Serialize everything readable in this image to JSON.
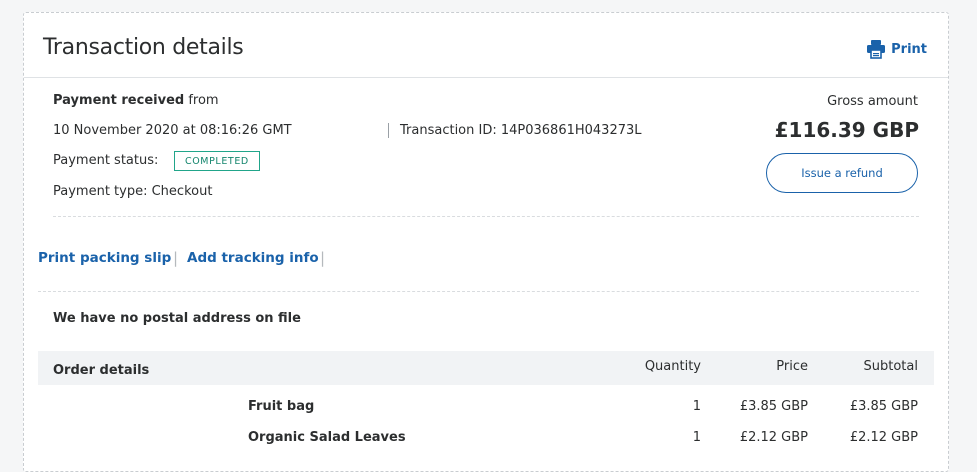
{
  "header": {
    "title": "Transaction details",
    "print_label": "Print"
  },
  "payment": {
    "status_prefix": "Payment received",
    "status_suffix": " from",
    "datetime": "10 November 2020 at 08:16:26 GMT",
    "transaction_id_label": "Transaction ID: ",
    "transaction_id": "14P036861H043273L",
    "status_label": "Payment status:",
    "status_value": "COMPLETED",
    "type_label": "Payment type: ",
    "type_value": "Checkout",
    "gross_label": "Gross amount",
    "gross_amount": "£116.39 GBP",
    "refund_label": "Issue a refund",
    "status_color": "#21a58a"
  },
  "actions": {
    "packing_slip": "Print packing slip",
    "tracking": "Add tracking info"
  },
  "address": {
    "message": "We have no postal address on file"
  },
  "order": {
    "header": "Order details",
    "columns": {
      "quantity": "Quantity",
      "price": "Price",
      "subtotal": "Subtotal"
    },
    "items": [
      {
        "name": "Fruit bag",
        "quantity": "1",
        "price": "£3.85 GBP",
        "subtotal": "£3.85 GBP"
      },
      {
        "name": "Organic Salad Leaves",
        "quantity": "1",
        "price": "£2.12 GBP",
        "subtotal": "£2.12 GBP"
      }
    ]
  },
  "colors": {
    "link": "#1a62aa",
    "badge": "#21a58a"
  },
  "icons": {
    "print": "printer-icon"
  }
}
